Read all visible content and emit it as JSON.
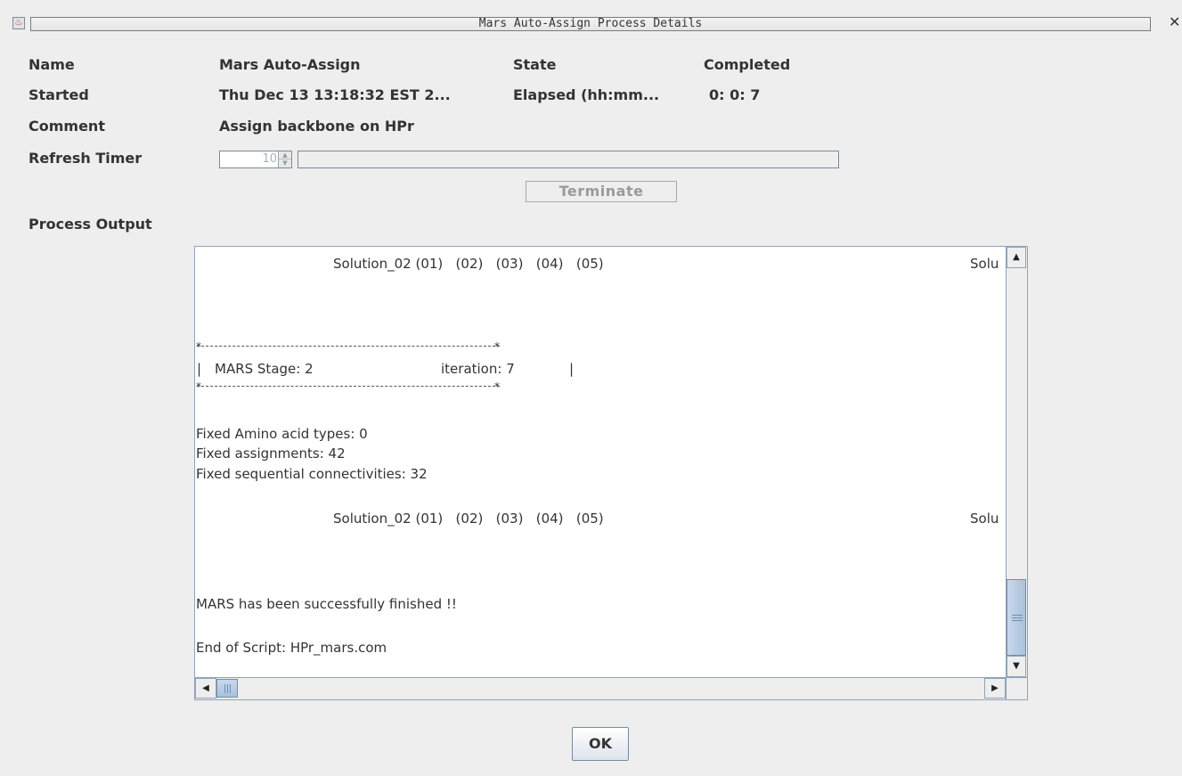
{
  "window": {
    "title": "Mars Auto-Assign Process Details"
  },
  "info": {
    "name_label": "Name",
    "name_value": "Mars Auto-Assign",
    "state_label": "State",
    "state_value": "Completed",
    "started_label": "Started",
    "started_value": "Thu Dec 13 13:18:32 EST 2...",
    "elapsed_label": "Elapsed (hh:mm...",
    "elapsed_value": "0: 0: 7",
    "comment_label": "Comment",
    "comment_value": "Assign backbone on HPr",
    "refresh_label": "Refresh Timer",
    "refresh_value": "10"
  },
  "buttons": {
    "terminate": "Terminate",
    "ok": "OK"
  },
  "output": {
    "label": "Process Output",
    "solution_line_1": "Solution_02 (01)   (02)   (03)   (04)   (05)",
    "solution_right_1": "Solu",
    "stage_text": "MARS Stage: 2",
    "iteration_text": "iteration: 7",
    "fixed_types": "Fixed Amino acid types: 0",
    "fixed_assignments": "Fixed assignments: 42",
    "fixed_connectivities": "Fixed sequential connectivities: 32",
    "solution_line_2": "Solution_02 (01)   (02)   (03)   (04)   (05)",
    "solution_right_2": "Solu",
    "finished": "MARS has been successfully finished !!",
    "end_script": "End of Script: HPr_mars.com"
  }
}
